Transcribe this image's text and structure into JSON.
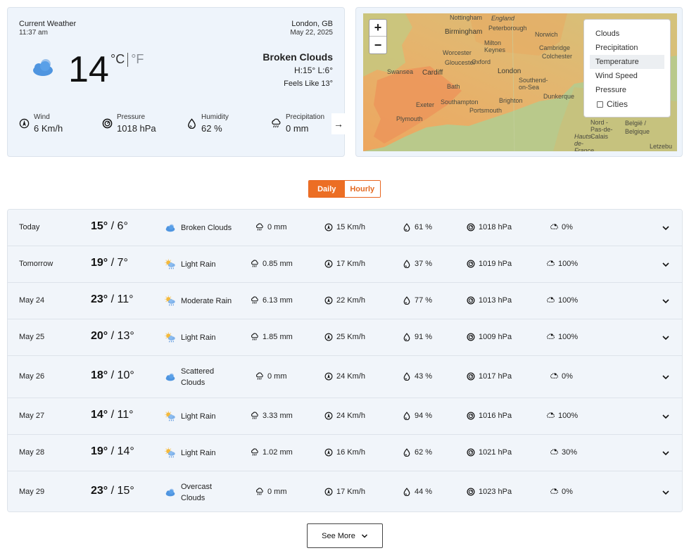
{
  "current": {
    "label": "Current Weather",
    "time": "11:37 am",
    "location": "London, GB",
    "date": "May 22, 2025",
    "temperature": "14",
    "unit_c": "°C",
    "unit_f": "°F",
    "condition": "Broken Clouds",
    "high_low": "H:15° L:6°",
    "feels_like": "Feels Like 13°",
    "icon": "cloud-icon",
    "stats": [
      {
        "label": "Wind",
        "value": "6 Km/h",
        "icon": "wind-icon"
      },
      {
        "label": "Pressure",
        "value": "1018 hPa",
        "icon": "pressure-icon"
      },
      {
        "label": "Humidity",
        "value": "62 %",
        "icon": "humidity-icon"
      },
      {
        "label": "Precipitation",
        "value": "0 mm",
        "icon": "precipitation-icon"
      }
    ],
    "more_arrow": "→"
  },
  "map": {
    "zoom_in": "+",
    "zoom_out": "−",
    "layers": [
      "Clouds",
      "Precipitation",
      "Temperature",
      "Wind Speed",
      "Pressure"
    ],
    "selected_layer": "Temperature",
    "cities_label": "Cities",
    "cities_checked": false,
    "places": [
      "Nottingham",
      "England",
      "Birmingham",
      "Peterborough",
      "Norwich",
      "Worcester",
      "Milton Keynes",
      "Cambridge",
      "Colchester",
      "Gloucester",
      "Oxford",
      "London",
      "Swansea",
      "Cardiff",
      "Southend-on-Sea",
      "Bath",
      "Exeter",
      "Southampton",
      "Portsmouth",
      "Brighton",
      "Dunkerque",
      "Plymouth",
      "Nord - Pas-de-Calais",
      "België / Belgique",
      "Hauts-de-France",
      "Letzebu"
    ]
  },
  "view_toggle": {
    "daily": "Daily",
    "hourly": "Hourly",
    "active": "Daily"
  },
  "forecast": [
    {
      "day": "Today",
      "high": "15°",
      "low": "6°",
      "condition": "Broken Clouds",
      "icon": "cloud-icon",
      "precip": "0 mm",
      "wind": "15 Km/h",
      "humidity": "61 %",
      "pressure": "1018 hPa",
      "chance": "0%"
    },
    {
      "day": "Tomorrow",
      "high": "19°",
      "low": "7°",
      "condition": "Light Rain",
      "icon": "sun-rain-icon",
      "precip": "0.85 mm",
      "wind": "17 Km/h",
      "humidity": "37 %",
      "pressure": "1019 hPa",
      "chance": "100%"
    },
    {
      "day": "May 24",
      "high": "23°",
      "low": "11°",
      "condition": "Moderate Rain",
      "icon": "sun-rain-icon",
      "precip": "6.13 mm",
      "wind": "22 Km/h",
      "humidity": "77 %",
      "pressure": "1013 hPa",
      "chance": "100%"
    },
    {
      "day": "May 25",
      "high": "20°",
      "low": "13°",
      "condition": "Light Rain",
      "icon": "sun-rain-icon",
      "precip": "1.85 mm",
      "wind": "25 Km/h",
      "humidity": "91 %",
      "pressure": "1009 hPa",
      "chance": "100%"
    },
    {
      "day": "May 26",
      "high": "18°",
      "low": "10°",
      "condition": "Scattered Clouds",
      "icon": "cloud-icon",
      "precip": "0 mm",
      "wind": "24 Km/h",
      "humidity": "43 %",
      "pressure": "1017 hPa",
      "chance": "0%"
    },
    {
      "day": "May 27",
      "high": "14°",
      "low": "11°",
      "condition": "Light Rain",
      "icon": "sun-rain-icon",
      "precip": "3.33 mm",
      "wind": "24 Km/h",
      "humidity": "94 %",
      "pressure": "1016 hPa",
      "chance": "100%"
    },
    {
      "day": "May 28",
      "high": "19°",
      "low": "14°",
      "condition": "Light Rain",
      "icon": "sun-rain-icon",
      "precip": "1.02 mm",
      "wind": "16 Km/h",
      "humidity": "62 %",
      "pressure": "1021 hPa",
      "chance": "30%"
    },
    {
      "day": "May 29",
      "high": "23°",
      "low": "15°",
      "condition": "Overcast Clouds",
      "icon": "cloud-icon",
      "precip": "0 mm",
      "wind": "17 Km/h",
      "humidity": "44 %",
      "pressure": "1023 hPa",
      "chance": "0%"
    }
  ],
  "see_more": "See More",
  "colors": {
    "accent": "#ec6e24",
    "card_bg": "#eef4fb",
    "row_bg": "#f1f5fa"
  }
}
